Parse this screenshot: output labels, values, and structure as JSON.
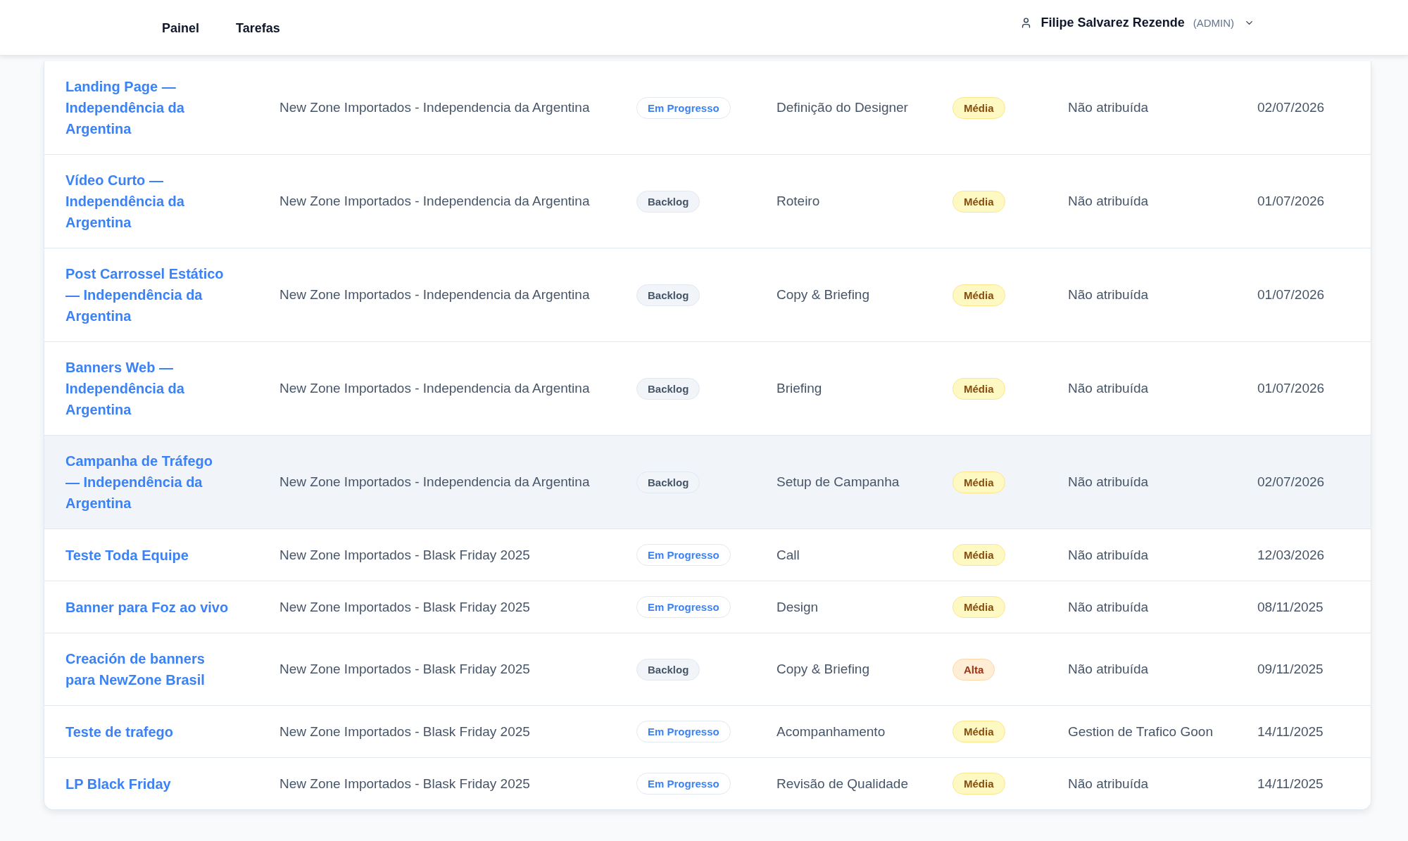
{
  "nav": [
    "Painel",
    "Tarefas"
  ],
  "user": {
    "name": "Filipe Salvarez Rezende",
    "role": "(ADMIN)"
  },
  "table": {
    "rows": [
      {
        "title": "Landing Page — Independência da Argentina",
        "project": "New Zone Importados - Independencia da Argentina",
        "status": {
          "label": "Em Progresso",
          "kind": "in_progress"
        },
        "stage": "Definição do Designer",
        "priority": {
          "label": "Média",
          "kind": "medium"
        },
        "assignee": "Não atribuída",
        "due": "02/07/2026",
        "selected": false
      },
      {
        "title": "Vídeo Curto — Independência da Argentina",
        "project": "New Zone Importados - Independencia da Argentina",
        "status": {
          "label": "Backlog",
          "kind": "backlog"
        },
        "stage": "Roteiro",
        "priority": {
          "label": "Média",
          "kind": "medium"
        },
        "assignee": "Não atribuída",
        "due": "01/07/2026",
        "selected": false
      },
      {
        "title": "Post Carrossel Estático — Independência da Argentina",
        "project": "New Zone Importados - Independencia da Argentina",
        "status": {
          "label": "Backlog",
          "kind": "backlog"
        },
        "stage": "Copy & Briefing",
        "priority": {
          "label": "Média",
          "kind": "medium"
        },
        "assignee": "Não atribuída",
        "due": "01/07/2026",
        "selected": false
      },
      {
        "title": "Banners Web — Independência da Argentina",
        "project": "New Zone Importados - Independencia da Argentina",
        "status": {
          "label": "Backlog",
          "kind": "backlog"
        },
        "stage": "Briefing",
        "priority": {
          "label": "Média",
          "kind": "medium"
        },
        "assignee": "Não atribuída",
        "due": "01/07/2026",
        "selected": false
      },
      {
        "title": "Campanha de Tráfego — Independência da Argentina",
        "project": "New Zone Importados - Independencia da Argentina",
        "status": {
          "label": "Backlog",
          "kind": "backlog"
        },
        "stage": "Setup de Campanha",
        "priority": {
          "label": "Média",
          "kind": "medium"
        },
        "assignee": "Não atribuída",
        "due": "02/07/2026",
        "selected": true
      },
      {
        "title": "Teste Toda Equipe",
        "project": "New Zone Importados - Blask Friday 2025",
        "status": {
          "label": "Em Progresso",
          "kind": "in_progress"
        },
        "stage": "Call",
        "priority": {
          "label": "Média",
          "kind": "medium"
        },
        "assignee": "Não atribuída",
        "due": "12/03/2026",
        "selected": false
      },
      {
        "title": "Banner para Foz ao vivo",
        "project": "New Zone Importados - Blask Friday 2025",
        "status": {
          "label": "Em Progresso",
          "kind": "in_progress"
        },
        "stage": "Design",
        "priority": {
          "label": "Média",
          "kind": "medium"
        },
        "assignee": "Não atribuída",
        "due": "08/11/2025",
        "selected": false
      },
      {
        "title": "Creación de banners para NewZone Brasil",
        "project": "New Zone Importados - Blask Friday 2025",
        "status": {
          "label": "Backlog",
          "kind": "backlog"
        },
        "stage": "Copy & Briefing",
        "priority": {
          "label": "Alta",
          "kind": "high"
        },
        "assignee": "Não atribuída",
        "due": "09/11/2025",
        "selected": false
      },
      {
        "title": "Teste de trafego",
        "project": "New Zone Importados - Blask Friday 2025",
        "status": {
          "label": "Em Progresso",
          "kind": "in_progress"
        },
        "stage": "Acompanhamento",
        "priority": {
          "label": "Média",
          "kind": "medium"
        },
        "assignee": "Gestion de Trafico Goon",
        "due": "14/11/2025",
        "selected": false
      },
      {
        "title": "LP Black Friday",
        "project": "New Zone Importados - Blask Friday 2025",
        "status": {
          "label": "Em Progresso",
          "kind": "in_progress"
        },
        "stage": "Revisão de Qualidade",
        "priority": {
          "label": "Média",
          "kind": "medium"
        },
        "assignee": "Não atribuída",
        "due": "14/11/2025",
        "selected": false
      }
    ]
  }
}
